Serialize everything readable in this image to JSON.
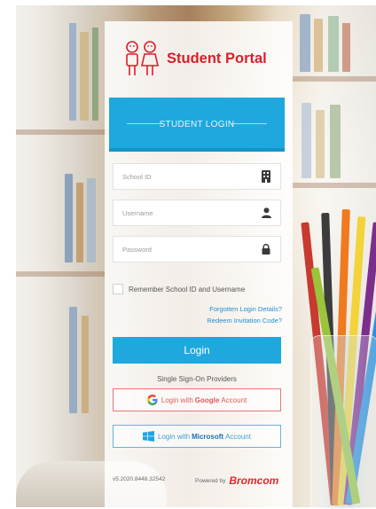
{
  "brand": {
    "title": "Student Portal",
    "logo_icon": "student-figures-logo",
    "accent_color": "#1fa8dd",
    "brand_red": "#d71f2b"
  },
  "header": {
    "title": "STUDENT LOGIN"
  },
  "form": {
    "school_id": {
      "placeholder": "School ID",
      "icon": "building-icon"
    },
    "username": {
      "placeholder": "Username",
      "icon": "user-icon"
    },
    "password": {
      "placeholder": "Password",
      "icon": "lock-icon"
    },
    "remember_label": "Remember School ID and Username",
    "forgot_link": "Forgotten Login Details?",
    "redeem_link": "Redeem Invitation Code?",
    "login_label": "Login"
  },
  "sso": {
    "label": "Single Sign-On Providers",
    "google": {
      "prefix": "Login with",
      "provider": "Google",
      "suffix": "Account",
      "color": "#e05b5b"
    },
    "microsoft": {
      "prefix": "Login with",
      "provider": "Microsoft",
      "suffix": "Account",
      "color": "#3b9fd1"
    }
  },
  "footer": {
    "version": "v5.2020.8448.32542",
    "powered_by": "Powered by",
    "company": "Bromcom"
  }
}
